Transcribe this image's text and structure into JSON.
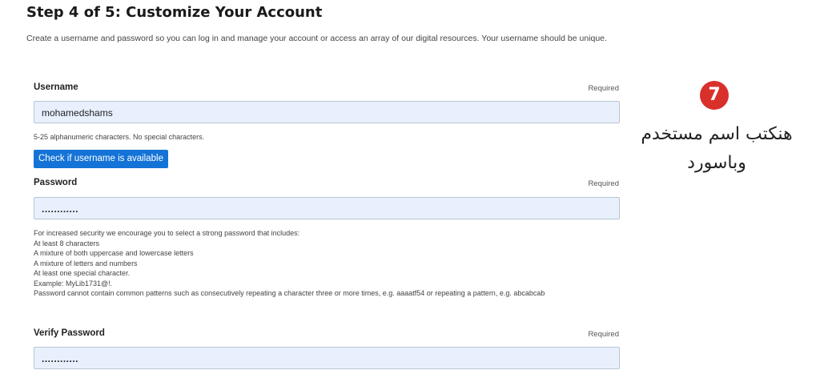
{
  "step_title": "Step 4 of 5: Customize Your Account",
  "intro": "Create a username and password so you can log in and manage your account or access an array of our digital resources. Your username should be unique.",
  "username": {
    "label": "Username",
    "required": "Required",
    "value": "mohamedshams",
    "help": "5-25 alphanumeric characters. No special characters.",
    "check_button": "Check if username is available"
  },
  "password": {
    "label": "Password",
    "required": "Required",
    "value": "............",
    "help_lines": [
      "For increased security we encourage you to select a strong password that includes:",
      "At least 8 characters",
      "A mixture of both uppercase and lowercase letters",
      "A mixture of letters and numbers",
      "At least one special character.",
      "Example: MyLib1731@!.",
      "Password cannot contain common patterns such as consecutively repeating a character three or more times, e.g. aaaatf54 or repeating a pattern, e.g. abcabcab"
    ]
  },
  "verify_password": {
    "label": "Verify Password",
    "required": "Required",
    "value": "............"
  },
  "annotation": {
    "step_number": "7",
    "line1": "هنكتب اسم مستخدم",
    "line2": "وباسورد"
  },
  "colors": {
    "button": "#1473d6",
    "input_background": "#e8f0fe",
    "badge": "#d9302c"
  }
}
